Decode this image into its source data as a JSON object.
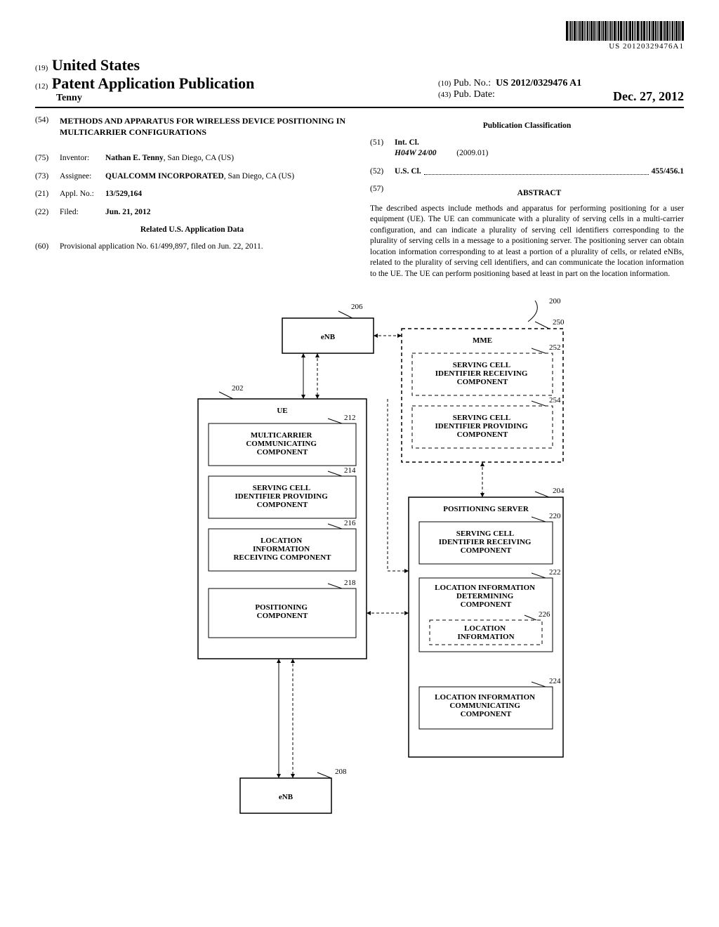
{
  "barcode_text": "US 20120329476A1",
  "header": {
    "country_code": "(19)",
    "country": "United States",
    "doc_code": "(12)",
    "doc_type": "Patent Application Publication",
    "author": "Tenny",
    "pubno_code": "(10)",
    "pubno_label": "Pub. No.:",
    "pubno": "US 2012/0329476 A1",
    "pubdate_code": "(43)",
    "pubdate_label": "Pub. Date:",
    "pubdate": "Dec. 27, 2012"
  },
  "left": {
    "title_code": "(54)",
    "title": "METHODS AND APPARATUS FOR WIRELESS DEVICE POSITIONING IN MULTICARRIER CONFIGURATIONS",
    "inventor_code": "(75)",
    "inventor_label": "Inventor:",
    "inventor": "Nathan E. Tenny",
    "inventor_loc": ", San Diego, CA (US)",
    "assignee_code": "(73)",
    "assignee_label": "Assignee:",
    "assignee": "QUALCOMM INCORPORATED",
    "assignee_loc": ", San Diego, CA (US)",
    "applno_code": "(21)",
    "applno_label": "Appl. No.:",
    "applno": "13/529,164",
    "filed_code": "(22)",
    "filed_label": "Filed:",
    "filed": "Jun. 21, 2012",
    "related_head": "Related U.S. Application Data",
    "prov_code": "(60)",
    "prov_text": "Provisional application No. 61/499,897, filed on Jun. 22, 2011."
  },
  "right": {
    "class_head": "Publication Classification",
    "intcl_code": "(51)",
    "intcl_label": "Int. Cl.",
    "intcl_val": "H04W 24/00",
    "intcl_year": "(2009.01)",
    "uscl_code": "(52)",
    "uscl_label": "U.S. Cl.",
    "uscl_val": "455/456.1",
    "abstract_code": "(57)",
    "abstract_label": "ABSTRACT",
    "abstract_text": "The described aspects include methods and apparatus for performing positioning for a user equipment (UE). The UE can communicate with a plurality of serving cells in a multi-carrier configuration, and can indicate a plurality of serving cell identifiers corresponding to the plurality of serving cells in a message to a positioning server. The positioning server can obtain location information corresponding to at least a portion of a plurality of cells, or related eNBs, related to the plurality of serving cell identifiers, and can communicate the location information to the UE. The UE can perform positioning based at least in part on the location information."
  },
  "figure": {
    "ref200": "200",
    "ref206": "206",
    "ref250": "250",
    "ref252": "252",
    "ref254": "254",
    "ref202": "202",
    "ref212": "212",
    "ref214": "214",
    "ref216": "216",
    "ref218": "218",
    "ref204": "204",
    "ref220": "220",
    "ref222": "222",
    "ref226": "226",
    "ref224": "224",
    "ref208": "208",
    "enb": "eNB",
    "ue": "UE",
    "mme": "MME",
    "multicarrier": "MULTICARRIER COMMUNICATING COMPONENT",
    "sci_providing": "SERVING CELL IDENTIFIER PROVIDING COMPONENT",
    "sci_receiving": "SERVING CELL IDENTIFIER RECEIVING COMPONENT",
    "loc_info_recv": "LOCATION INFORMATION RECEIVING COMPONENT",
    "positioning_comp": "POSITIONING COMPONENT",
    "positioning_server": "POSITIONING SERVER",
    "loc_info_det": "LOCATION INFORMATION DETERMINING COMPONENT",
    "loc_info": "LOCATION INFORMATION",
    "loc_info_comm": "LOCATION INFORMATION COMMUNICATING COMPONENT"
  }
}
